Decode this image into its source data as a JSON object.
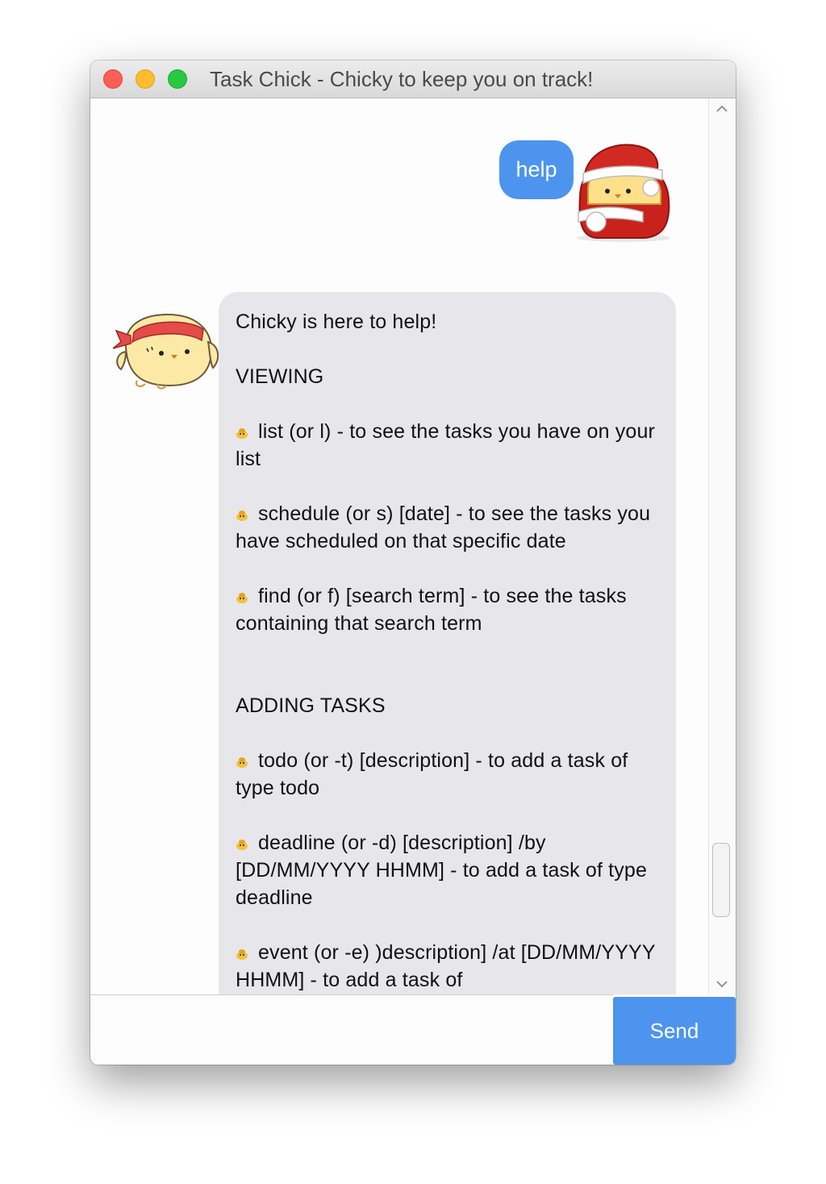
{
  "window": {
    "title": "Task Chick - Chicky to keep you on track!"
  },
  "chat": {
    "user_message": "help",
    "bot_message": {
      "intro": "Chicky is here to help!",
      "sections": [
        {
          "heading": "VIEWING",
          "commands": [
            "list (or l) - to see the tasks you have on your list",
            "schedule (or s) [date] - to see the tasks you have scheduled on that specific date",
            "find (or f) [search term] - to see the tasks containing that search term"
          ]
        },
        {
          "heading": "ADDING TASKS",
          "commands": [
            "todo (or -t) [description] - to add a task of type todo",
            "deadline (or -d) [description] /by [DD/MM/YYYY HHMM] - to add a task of type deadline",
            "event (or -e) )description] /at [DD/MM/YYYY HHMM] - to add a task of"
          ]
        }
      ]
    }
  },
  "input": {
    "value": "",
    "send_label": "Send"
  },
  "colors": {
    "accent": "#4d94ee",
    "bot_bubble": "#e7e7eb"
  },
  "icons": {
    "user_avatar": "chick-santa-hat-avatar",
    "bot_avatar": "chick-headband-avatar",
    "bullet": "chick-bullet-icon"
  }
}
